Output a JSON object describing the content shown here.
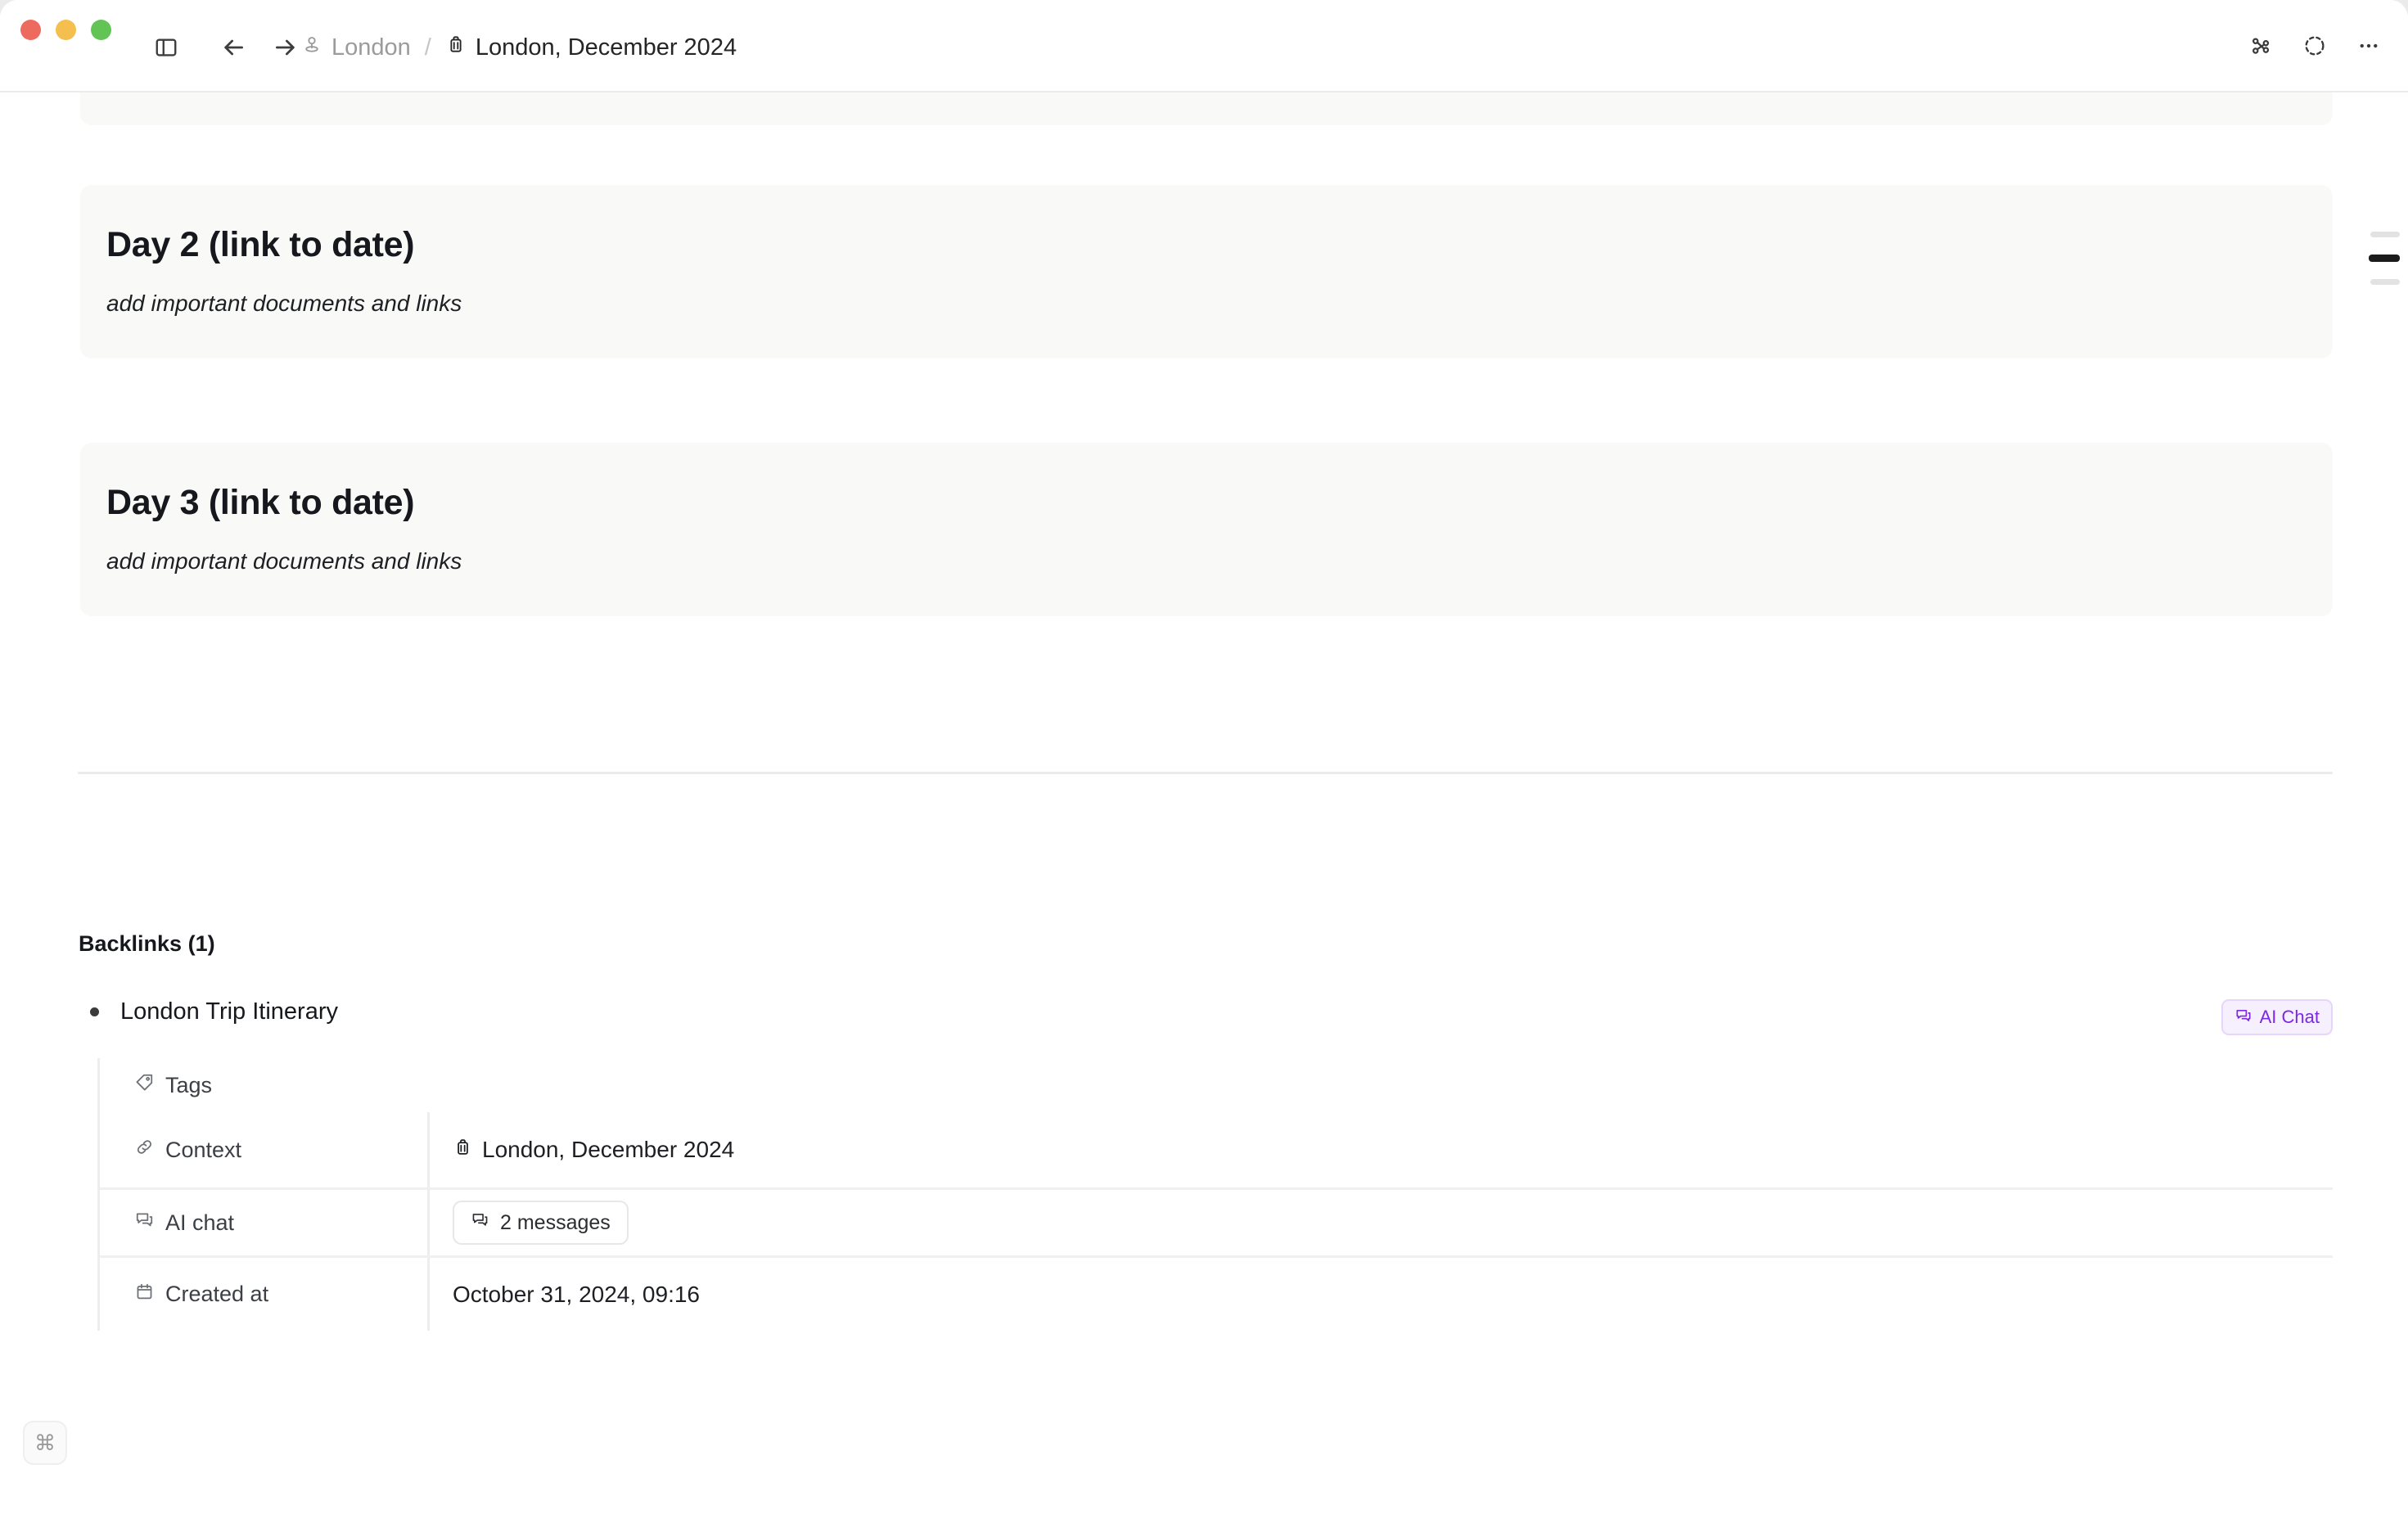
{
  "window": {
    "traffic_lights": [
      {
        "name": "close",
        "color": "#ed6a5e"
      },
      {
        "name": "minimize",
        "color": "#f4bf4f"
      },
      {
        "name": "maximize",
        "color": "#61c454"
      }
    ]
  },
  "toolbar": {
    "sidebar_toggle_icon": "sidebar-toggle-icon",
    "back_icon": "arrow-left-icon",
    "forward_icon": "arrow-right-icon",
    "graph_icon": "graph-view-icon",
    "focus_icon": "dashed-circle-icon",
    "more_icon": "ellipsis-icon"
  },
  "breadcrumb": {
    "separator": "/",
    "items": [
      {
        "label": "London",
        "icon": "map-pin-icon",
        "active": false
      },
      {
        "label": "London, December 2024",
        "icon": "suitcase-icon",
        "active": true
      }
    ]
  },
  "document": {
    "cards": [
      {
        "title": "Day 2 (link to date)",
        "subtitle": "add important documents and links"
      },
      {
        "title": "Day 3 (link to date)",
        "subtitle": "add important documents and links"
      }
    ]
  },
  "outline_markers": [
    {
      "state": "dim"
    },
    {
      "state": "active"
    },
    {
      "state": "dim"
    }
  ],
  "backlinks": {
    "heading": "Backlinks (1)",
    "items": [
      {
        "title": "London Trip Itinerary",
        "badge": {
          "label": "AI Chat",
          "icon": "chat-icon",
          "color": "#7d29e0"
        },
        "properties": [
          {
            "key": "Tags",
            "key_icon": "tag-icon",
            "value": "",
            "value_icon": "",
            "type": "empty"
          },
          {
            "key": "Context",
            "key_icon": "link-icon",
            "value": "London, December 2024",
            "value_icon": "suitcase-icon",
            "type": "reference"
          },
          {
            "key": "AI chat",
            "key_icon": "chat-icon",
            "value": "2 messages",
            "value_icon": "chat-icon",
            "type": "pill"
          },
          {
            "key": "Created at",
            "key_icon": "calendar-icon",
            "value": "October 31, 2024, 09:16",
            "value_icon": "",
            "type": "text"
          }
        ]
      }
    ]
  },
  "footer": {
    "command_button_glyph": "⌘"
  },
  "colors": {
    "card_bg": "#f9f9f8",
    "page_bg": "#ffffff",
    "accent_purple": "#7d29e0",
    "divider": "#ebebeb",
    "text_primary": "#16181d",
    "text_muted": "#9b9b9b"
  }
}
